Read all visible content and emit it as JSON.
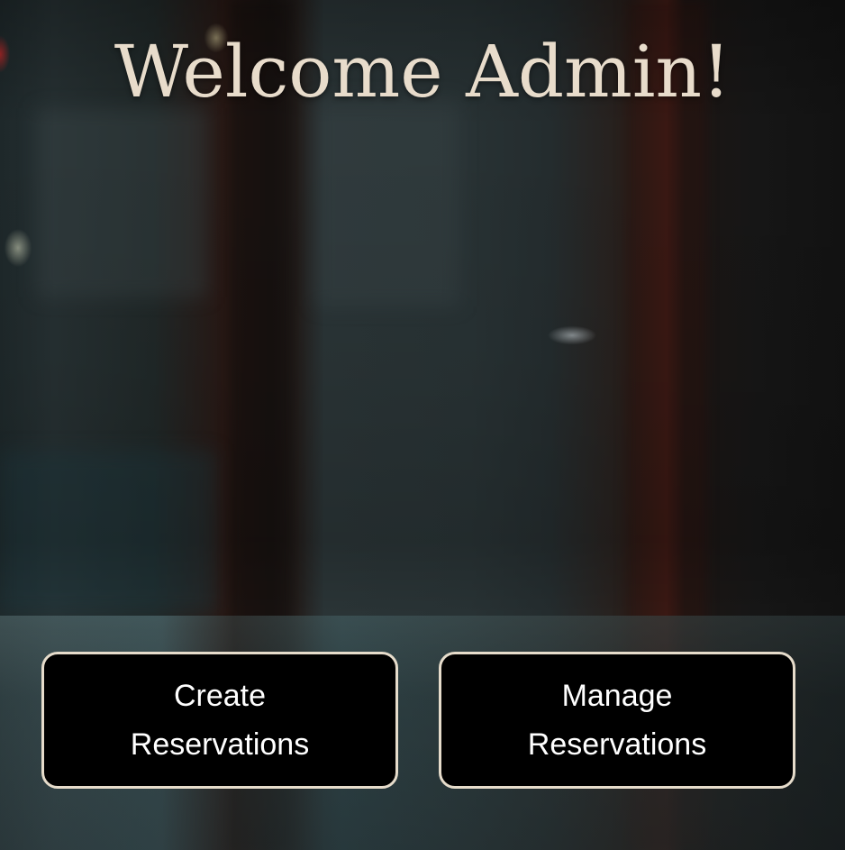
{
  "header": {
    "title": "Welcome Admin!"
  },
  "actions": {
    "create": {
      "line1": "Create",
      "line2": "Reservations"
    },
    "manage": {
      "line1": "Manage",
      "line2": "Reservations"
    }
  },
  "colors": {
    "title_text": "#e8dccb",
    "button_background": "#000000",
    "button_border": "#e6dccb",
    "button_text": "#ffffff"
  }
}
